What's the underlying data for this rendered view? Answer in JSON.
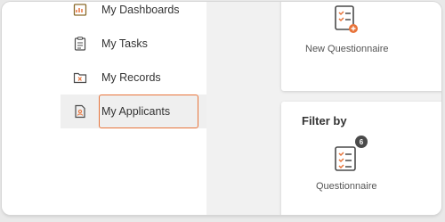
{
  "sidebar": {
    "items": [
      {
        "label": "My Dashboards",
        "icon": "dashboard-icon"
      },
      {
        "label": "My Tasks",
        "icon": "tasks-clipboard-icon"
      },
      {
        "label": "My Records",
        "icon": "records-folder-icon"
      },
      {
        "label": "My Applicants",
        "icon": "applicants-document-icon",
        "selected": true
      }
    ]
  },
  "main": {
    "new_questionnaire_label": "New Questionnaire",
    "filter": {
      "title": "Filter by",
      "questionnaire_label": "Questionnaire",
      "questionnaire_count": "6"
    }
  },
  "colors": {
    "highlight": "#e8743b",
    "icon_orange": "#e8743b",
    "icon_dark": "#4a4a4a"
  }
}
